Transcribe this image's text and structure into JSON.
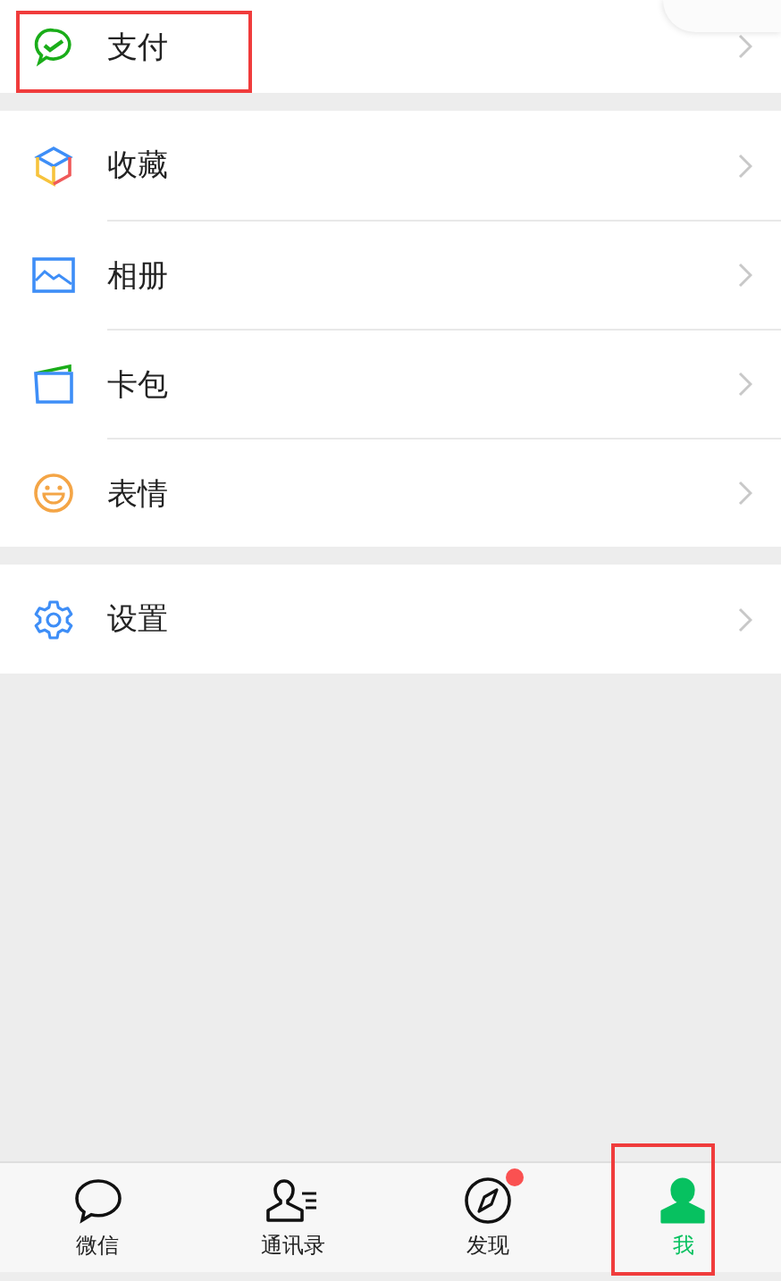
{
  "groups": [
    {
      "items": [
        {
          "kind": "pay",
          "label": "支付",
          "annotated": true
        }
      ]
    },
    {
      "items": [
        {
          "kind": "favorites",
          "label": "收藏",
          "annotated": false
        },
        {
          "kind": "album",
          "label": "相册",
          "annotated": false
        },
        {
          "kind": "cards",
          "label": "卡包",
          "annotated": false
        },
        {
          "kind": "stickers",
          "label": "表情",
          "annotated": false
        }
      ]
    },
    {
      "items": [
        {
          "kind": "settings",
          "label": "设置",
          "annotated": false
        }
      ]
    }
  ],
  "tabs": [
    {
      "kind": "chat",
      "label": "微信",
      "selected": false,
      "dot": false,
      "annotated": false
    },
    {
      "kind": "contacts",
      "label": "通讯录",
      "selected": false,
      "dot": false,
      "annotated": false
    },
    {
      "kind": "discover",
      "label": "发现",
      "selected": false,
      "dot": true,
      "annotated": false
    },
    {
      "kind": "me",
      "label": "我",
      "selected": true,
      "dot": false,
      "annotated": true
    }
  ]
}
